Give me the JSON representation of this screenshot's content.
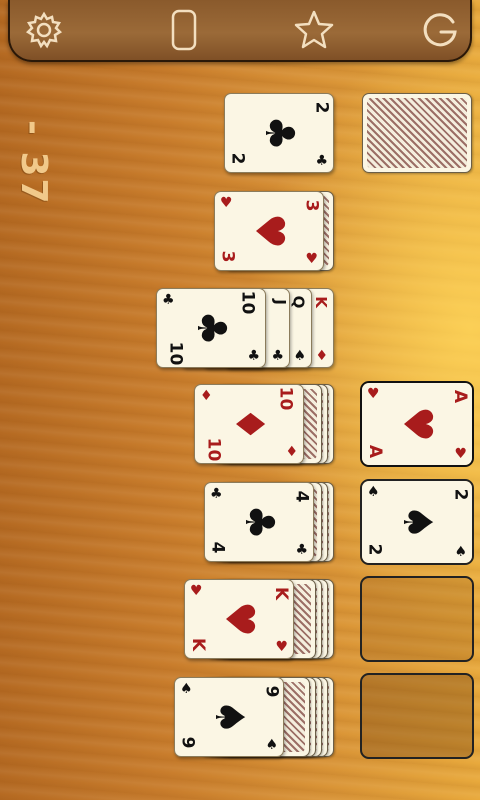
{
  "toolbar": {
    "buttons": [
      "settings",
      "card-deck",
      "star",
      "restart"
    ]
  },
  "score": "- 37",
  "stock": {
    "label": "stock"
  },
  "waste": {
    "rank": "2",
    "suit": "♣",
    "color": "black"
  },
  "tableau": [
    {
      "rank": "3",
      "suit": "♥",
      "color": "red",
      "hidden": 0
    },
    {
      "rank": "10",
      "suit": "♣",
      "color": "black",
      "peek": [
        {
          "rank": "J",
          "suit": "♣",
          "color": "black"
        },
        {
          "rank": "Q",
          "suit": "♠",
          "color": "black"
        },
        {
          "rank": "K",
          "suit": "♦",
          "color": "red"
        }
      ]
    },
    {
      "rank": "10",
      "suit": "♦",
      "color": "red",
      "hidden": 3
    },
    {
      "rank": "4",
      "suit": "♣",
      "color": "black",
      "hidden": 3
    },
    {
      "rank": "K",
      "suit": "♥",
      "color": "red",
      "hidden": 4
    },
    {
      "rank": "9",
      "suit": "♠",
      "color": "black",
      "hidden": 5
    }
  ],
  "foundations": [
    {
      "rank": "A",
      "suit": "♥",
      "color": "red"
    },
    {
      "rank": "2",
      "suit": "♠",
      "color": "black"
    },
    {
      "empty": true
    },
    {
      "empty": true
    }
  ]
}
